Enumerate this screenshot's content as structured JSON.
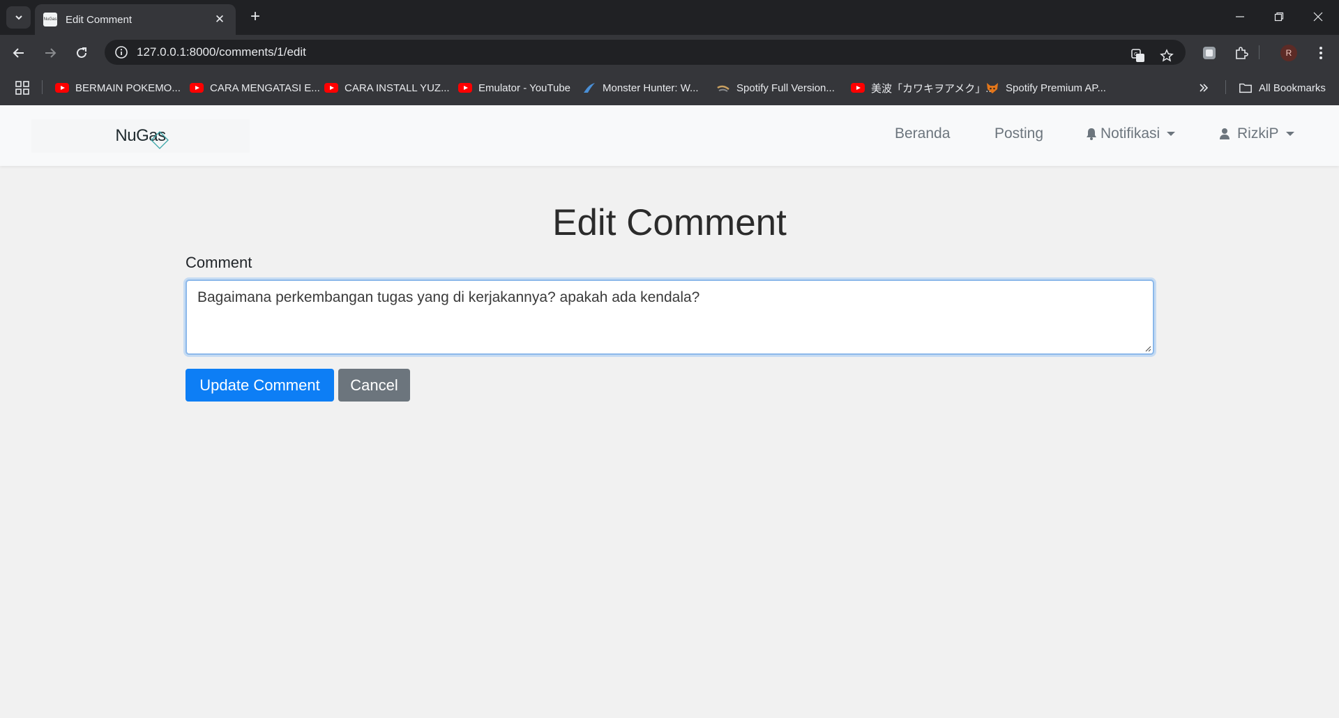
{
  "browser": {
    "tab_title": "Edit Comment",
    "url": "127.0.0.1:8000/comments/1/edit",
    "bookmarks": [
      {
        "label": "BERMAIN POKEMO...",
        "icon": "youtube-icon"
      },
      {
        "label": "CARA MENGATASI E...",
        "icon": "youtube-icon"
      },
      {
        "label": "CARA INSTALL YUZ...",
        "icon": "youtube-icon"
      },
      {
        "label": "Emulator - YouTube",
        "icon": "youtube-icon"
      },
      {
        "label": "Monster Hunter: W...",
        "icon": "monster-hunter-icon"
      },
      {
        "label": "Spotify Full Version...",
        "icon": "spotify-site-icon"
      },
      {
        "label": "美波「カワキヲアメク」...",
        "icon": "youtube-icon"
      },
      {
        "label": "Spotify Premium AP...",
        "icon": "fox-icon"
      }
    ],
    "all_bookmarks_label": "All Bookmarks",
    "profile_initial": "R",
    "favicon_text": "NuGas"
  },
  "navbar": {
    "brand": "NuGas",
    "links": {
      "beranda": "Beranda",
      "posting": "Posting",
      "notifikasi": "Notifikasi",
      "user": "RizkiP"
    }
  },
  "page": {
    "title": "Edit Comment",
    "comment_label": "Comment",
    "comment_value": "Bagaimana perkembangan tugas yang di kerjakannya? apakah ada kendala?",
    "update_button": "Update Comment",
    "cancel_button": "Cancel"
  },
  "colors": {
    "primary": "#0d7ef5",
    "secondary": "#6c757d",
    "chrome_dark": "#202124",
    "chrome_toolbar": "#35363a"
  }
}
